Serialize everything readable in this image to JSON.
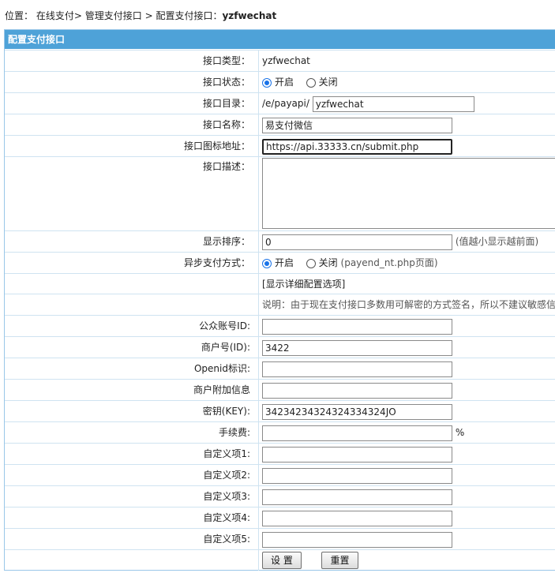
{
  "breadcrumb": {
    "prefix": "位置：",
    "item1": "在线支付>",
    "item2": "管理支付接口",
    "item3": "> 配置支付接口：",
    "current": "yzfwechat"
  },
  "panel": {
    "title": "配置支付接口"
  },
  "fields": {
    "type": {
      "label": "接口类型：",
      "value": "yzfwechat"
    },
    "status": {
      "label": "接口状态：",
      "option_on": "开启",
      "option_off": "关闭",
      "selected": "开启"
    },
    "dir": {
      "label": "接口目录：",
      "prefix": "/e/payapi/",
      "value": "yzfwechat"
    },
    "name": {
      "label": "接口名称：",
      "value": "易支付微信"
    },
    "icon_url": {
      "label": "接口图标地址：",
      "value": "https://api.33333.cn/submit.php"
    },
    "desc": {
      "label": "接口描述：",
      "value": ""
    },
    "order": {
      "label": "显示排序：",
      "value": "0",
      "hint": "(值越小显示越前面)"
    },
    "async": {
      "label": "异步支付方式：",
      "option_on": "开启",
      "option_off": "关闭",
      "selected": "开启",
      "hint": "(payend_nt.php页面)"
    },
    "show_detail": {
      "link": "[显示详细配置选项]"
    },
    "note": {
      "text": "说明：由于现在支付接口多数用可解密的方式签名，所以不建议敏感信"
    },
    "appid": {
      "label": "公众账号ID:",
      "value": ""
    },
    "merchant_id": {
      "label": "商户号(ID):",
      "value": "3422"
    },
    "openid": {
      "label": "Openid标识:",
      "value": ""
    },
    "merchant_extra": {
      "label": "商户附加信息",
      "value": ""
    },
    "key": {
      "label": "密钥(KEY):",
      "value": "34234234324324334324JO"
    },
    "fee": {
      "label": "手续费:",
      "value": "",
      "unit": "%"
    },
    "custom1": {
      "label": "自定义项1:",
      "value": ""
    },
    "custom2": {
      "label": "自定义项2:",
      "value": ""
    },
    "custom3": {
      "label": "自定义项3:",
      "value": ""
    },
    "custom4": {
      "label": "自定义项4:",
      "value": ""
    },
    "custom5": {
      "label": "自定义项5:",
      "value": ""
    }
  },
  "actions": {
    "submit": "设 置",
    "reset": "重置"
  }
}
